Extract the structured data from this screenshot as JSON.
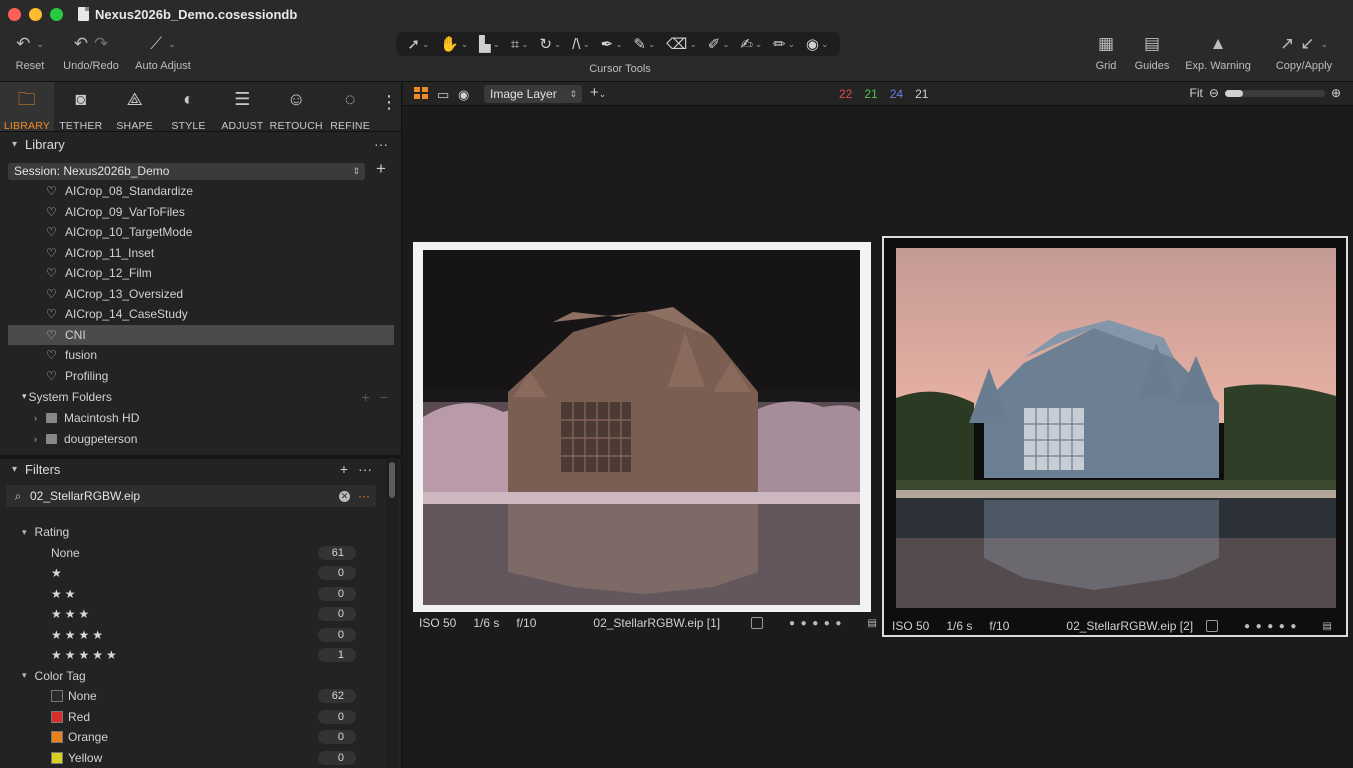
{
  "window": {
    "title": "Nexus2026b_Demo.cosessiondb"
  },
  "toolbar": {
    "reset_label": "Reset",
    "undo_redo_label": "Undo/Redo",
    "auto_adjust_label": "Auto Adjust",
    "cursor_tools_label": "Cursor Tools",
    "grid_label": "Grid",
    "guides_label": "Guides",
    "exp_warning_label": "Exp. Warning",
    "copy_apply_label": "Copy/Apply",
    "active_tool_color": "#f08a24"
  },
  "tabs": [
    {
      "label": "LIBRARY",
      "icon": "folder-icon",
      "active": true
    },
    {
      "label": "TETHER",
      "icon": "camera-icon"
    },
    {
      "label": "SHAPE",
      "icon": "shape-icon"
    },
    {
      "label": "STYLE",
      "icon": "style-icon"
    },
    {
      "label": "ADJUST",
      "icon": "sliders-icon"
    },
    {
      "label": "RETOUCH",
      "icon": "retouch-icon"
    },
    {
      "label": "REFINE",
      "icon": "refine-icon"
    }
  ],
  "library": {
    "title": "Library",
    "session": "Session: Nexus2026b_Demo",
    "albums": [
      "AICrop_08_Standardize",
      "AICrop_09_VarToFiles",
      "AICrop_10_TargetMode",
      "AICrop_11_Inset",
      "AICrop_12_Film",
      "AICrop_13_Oversized",
      "AICrop_14_CaseStudy",
      "CNI",
      "fusion",
      "Profiling"
    ],
    "selected_album": "CNI",
    "system_folders": {
      "title": "System Folders",
      "items": [
        "Macintosh HD",
        "dougpeterson"
      ]
    }
  },
  "filters": {
    "title": "Filters",
    "search_value": "02_StellarRGBW.eip",
    "rating": {
      "title": "Rating",
      "rows": [
        {
          "label": "None",
          "count": "61"
        },
        {
          "stars": "★",
          "count": "0"
        },
        {
          "stars": "★★",
          "count": "0"
        },
        {
          "stars": "★★★",
          "count": "0"
        },
        {
          "stars": "★★★★",
          "count": "0"
        },
        {
          "stars": "★★★★★",
          "count": "1"
        }
      ]
    },
    "color_tag": {
      "title": "Color Tag",
      "rows": [
        {
          "label": "None",
          "count": "62",
          "color": "#2a2a2a"
        },
        {
          "label": "Red",
          "count": "0",
          "color": "#d92c2c"
        },
        {
          "label": "Orange",
          "count": "0",
          "color": "#e8801e"
        },
        {
          "label": "Yellow",
          "count": "0",
          "color": "#d8d21e"
        }
      ]
    }
  },
  "viewer_bar": {
    "layer": "Image Layer",
    "counts": [
      {
        "value": "22",
        "color": "#e04a4a"
      },
      {
        "value": "21",
        "color": "#4ec24e"
      },
      {
        "value": "24",
        "color": "#6a7ee8"
      },
      {
        "value": "21",
        "color": "#d0d0d0"
      }
    ],
    "zoom_label": "Fit",
    "zoom_level": 0.18
  },
  "images": [
    {
      "iso": "ISO 50",
      "shutter": "1/6 s",
      "aperture": "f/10",
      "name": "02_StellarRGBW.eip [1]"
    },
    {
      "iso": "ISO 50",
      "shutter": "1/6 s",
      "aperture": "f/10",
      "name": "02_StellarRGBW.eip [2]"
    }
  ]
}
